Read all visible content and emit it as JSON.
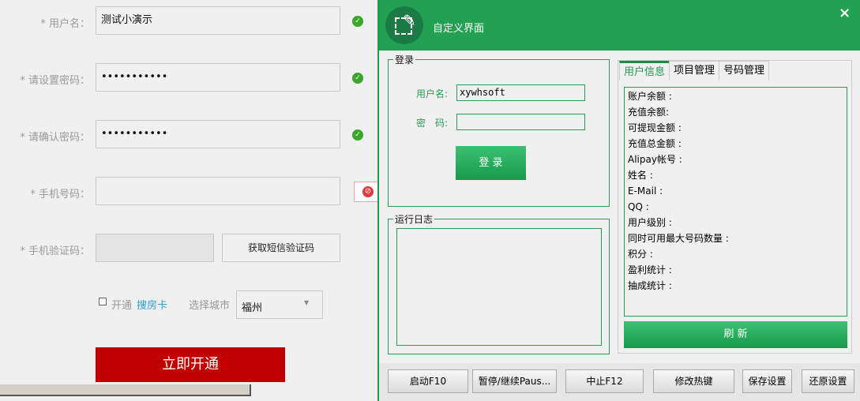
{
  "reg": {
    "fields": [
      {
        "label": "* 用户名：",
        "value": "测试小演示",
        "status": "ok"
      },
      {
        "label": "* 请设置密码：",
        "value": "•••••••••••",
        "status": "ok"
      },
      {
        "label": "* 请确认密码：",
        "value": "•••••••••••",
        "status": "ok"
      },
      {
        "label": "* 手机号码：",
        "value": "",
        "status": "error"
      },
      {
        "label": "* 手机验证码：",
        "value": ""
      }
    ],
    "sms_button": "获取短信验证码",
    "open_label": "开通",
    "open_link": "搜房卡",
    "city_label": "选择城市",
    "city_value": "福州",
    "submit": "立即开通"
  },
  "window": {
    "title": "自定义界面",
    "close": "×",
    "login_group": "登录",
    "username_label": "用户名:",
    "username_value": "xywhsoft",
    "password_label": "密　码:",
    "password_value": "",
    "login_button": "登 录",
    "log_group": "运行日志",
    "tabs": [
      "用户信息",
      "项目管理",
      "号码管理"
    ],
    "info": [
      "账户余额 :",
      "充值余额:",
      "可提现金额 :",
      "充值总金额 :",
      "Alipay帐号 :",
      "姓名 :",
      "E-Mail :",
      "QQ :",
      "用户级别 :",
      "同时可用最大号码数量 :",
      "积分 :",
      "盈利统计 :",
      "抽成统计 :"
    ],
    "refresh": "刷 新",
    "buttons": [
      "启动F10",
      "暂停/继续Paus...",
      "中止F12",
      "修改热键",
      "保存设置",
      "还原设置"
    ]
  },
  "colors": {
    "green": "#22a153",
    "red": "#c00000",
    "link": "#2a9fd6"
  }
}
